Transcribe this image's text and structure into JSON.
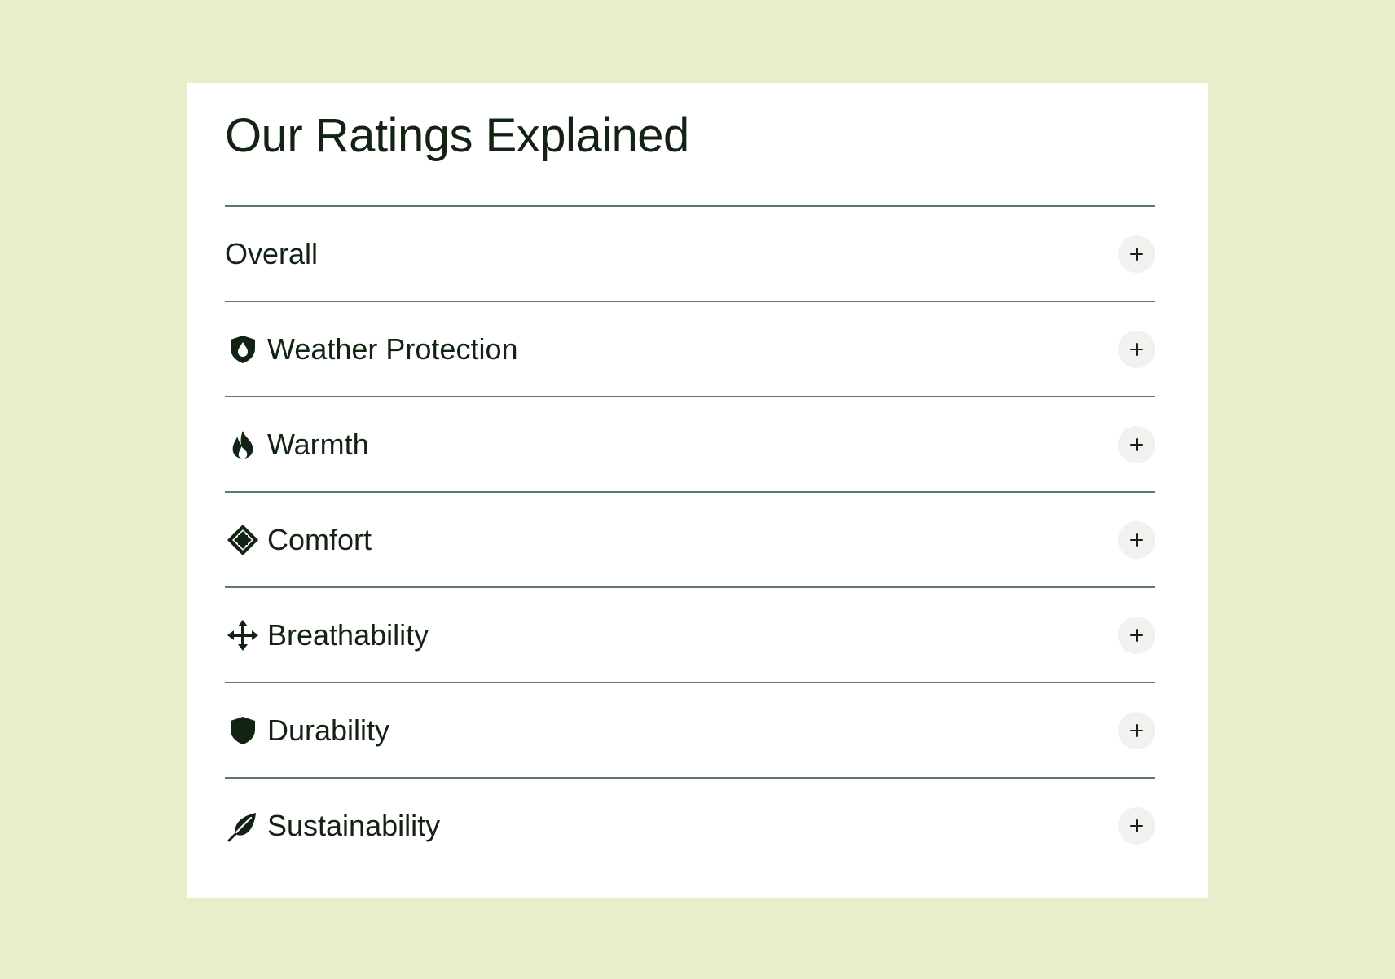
{
  "title": "Our Ratings Explained",
  "colors": {
    "page_background": "#e7eec9",
    "card_background": "#ffffff",
    "text": "#132313",
    "divider": "#5f7a66",
    "button_background": "#f1f1ef"
  },
  "items": [
    {
      "label": "Overall",
      "icon": null,
      "button_icon": "plus-icon"
    },
    {
      "label": "Weather Protection",
      "icon": "shield-drop-icon",
      "button_icon": "plus-icon"
    },
    {
      "label": "Warmth",
      "icon": "flame-icon",
      "button_icon": "plus-icon"
    },
    {
      "label": "Comfort",
      "icon": "diamond-arrows-icon",
      "button_icon": "plus-icon"
    },
    {
      "label": "Breathability",
      "icon": "move-arrows-icon",
      "button_icon": "plus-icon"
    },
    {
      "label": "Durability",
      "icon": "shield-icon",
      "button_icon": "plus-icon"
    },
    {
      "label": "Sustainability",
      "icon": "leaf-icon",
      "button_icon": "plus-icon"
    }
  ]
}
